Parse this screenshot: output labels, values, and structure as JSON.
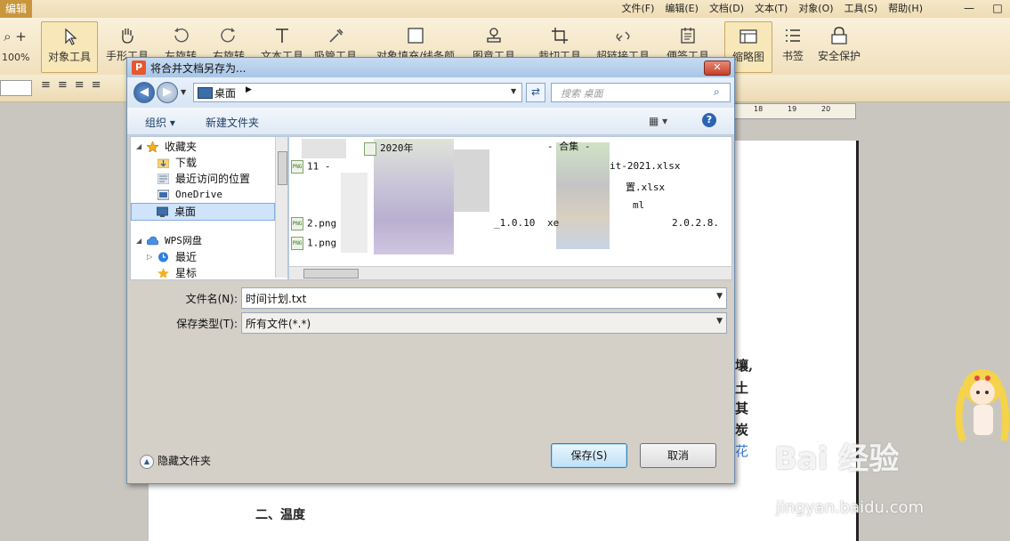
{
  "app": {
    "title": "编辑",
    "menu": [
      "文件(F)",
      "编辑(E)",
      "文档(D)",
      "文本(T)",
      "对象(O)",
      "工具(S)",
      "帮助(H)"
    ],
    "window_controls": [
      "—",
      "□"
    ]
  },
  "toolbar": {
    "zoom_label": "100%",
    "tools": [
      {
        "label": "对象工具",
        "icon": "cursor-icon",
        "active": true
      },
      {
        "label": "手形工具",
        "icon": "hand-icon"
      },
      {
        "label": "左旋转",
        "icon": "rotate-left-icon"
      },
      {
        "label": "右旋转",
        "icon": "rotate-right-icon"
      },
      {
        "label": "文本工具",
        "icon": "text-tool-icon"
      },
      {
        "label": "吸管工具",
        "icon": "eyedropper-icon"
      },
      {
        "label": "对象填充/线条颜",
        "icon": "fill-icon"
      },
      {
        "label": "图章工具",
        "icon": "stamp-icon"
      },
      {
        "label": "裁切工具",
        "icon": "crop-icon"
      },
      {
        "label": "超链接工具",
        "icon": "link-icon"
      },
      {
        "label": "便签工具",
        "icon": "note-icon"
      },
      {
        "label": "缩略图",
        "icon": "thumbnail-icon",
        "active": true
      },
      {
        "label": "书签",
        "icon": "bookmark-icon"
      },
      {
        "label": "安全保护",
        "icon": "lock-icon"
      }
    ]
  },
  "ruler": {
    "ticks": [
      "18",
      "19",
      "20"
    ]
  },
  "document": {
    "side_chars": [
      "壤,",
      "土",
      "其",
      "炭",
      "花"
    ],
    "heading": "二、温度"
  },
  "dialog": {
    "title": "将合并文档另存为...",
    "app_icon": "P",
    "close": "✕",
    "address": {
      "location": "桌面",
      "search_placeholder": "搜索 桌面"
    },
    "commands": {
      "organize": "组织 ▾",
      "new_folder": "新建文件夹",
      "help": "?"
    },
    "nav_tree": [
      {
        "label": "收藏夹",
        "icon": "star-icon",
        "level": 0,
        "expander": "◢"
      },
      {
        "label": "下载",
        "icon": "download-folder-icon",
        "level": 1
      },
      {
        "label": "最近访问的位置",
        "icon": "recent-places-icon",
        "level": 1
      },
      {
        "label": "OneDrive",
        "icon": "onedrive-icon",
        "level": 1
      },
      {
        "label": "桌面",
        "icon": "desktop-icon",
        "level": 1,
        "selected": true
      },
      {
        "label": "WPS网盘",
        "icon": "cloud-icon",
        "level": 0,
        "expander": "◢"
      },
      {
        "label": "最近",
        "icon": "clock-icon",
        "level": 1,
        "expander": "▷"
      },
      {
        "label": "星标",
        "icon": "star-mark-icon",
        "level": 1
      }
    ],
    "files_visible": [
      {
        "name": "11 -",
        "col": 0
      },
      {
        "name": "1.png",
        "col": 0
      },
      {
        "name": "2.png",
        "col": 0
      },
      {
        "name": "2020年",
        "col": 1
      },
      {
        "name": "xe",
        "col": 1
      },
      {
        "name": "_1.0.10",
        "col": 1
      },
      {
        "name": "- 合集 -",
        "col": 2
      },
      {
        "name": "it-2021.xlsx",
        "col": 2
      },
      {
        "name": "置.xlsx",
        "col": 2
      },
      {
        "name": "ml",
        "col": 2
      },
      {
        "name": "2.0.2.8.",
        "col": 2
      }
    ],
    "form": {
      "filename_label": "文件名(N):",
      "filename_value": "时间计划.txt",
      "type_label": "保存类型(T):",
      "type_value": "所有文件(*.*)"
    },
    "hide_folders": "隐藏文件夹",
    "save": "保存(S)",
    "cancel": "取消"
  },
  "watermark": {
    "main": "Bai 经验",
    "sub": "jingyan.baidu.com"
  },
  "colors": {
    "app_accent": "#c8963c",
    "dialog_title": "#a9c6e6",
    "selection": "#cfe3fb"
  }
}
